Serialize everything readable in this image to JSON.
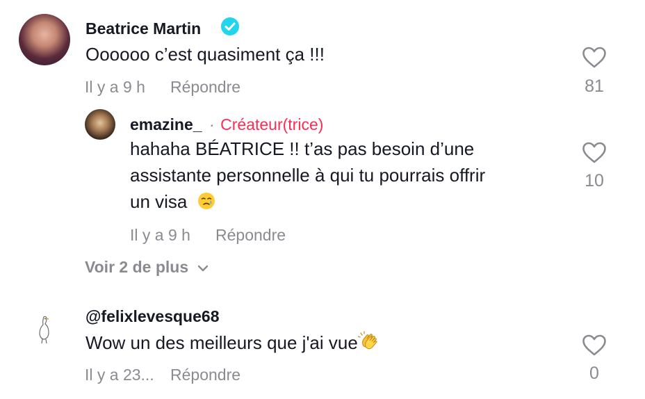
{
  "comments": [
    {
      "username": "Beatrice Martin",
      "verified": true,
      "text": "Oooooo c’est quasiment ça !!!",
      "time": "Il y a 9 h",
      "reply_label": "Répondre",
      "likes": "81",
      "replies": [
        {
          "username": "emazine_",
          "separator": "·",
          "badge": "Créateur(trice)",
          "text_lines": [
            "hahaha BÉATRICE !! t’as pas besoin d’une",
            "assistante personnelle à qui tu pourrais offrir",
            "un visa"
          ],
          "emoji_icon": "crying-face-emoji",
          "time": "Il y a 9 h",
          "reply_label": "Répondre",
          "likes": "10"
        }
      ],
      "more_replies_label": "Voir 2 de plus"
    },
    {
      "username": "@felixlevesque68",
      "verified": false,
      "text": "Wow un des meilleurs que j'ai vue",
      "emoji_icon": "clapping-hands-emoji",
      "time": "Il y a 23...",
      "reply_label": "Répondre",
      "likes": "0"
    }
  ],
  "colors": {
    "text": "#161823",
    "muted": "#8a8b91",
    "creator": "#fe2c55",
    "verified": "#20d5ec"
  }
}
